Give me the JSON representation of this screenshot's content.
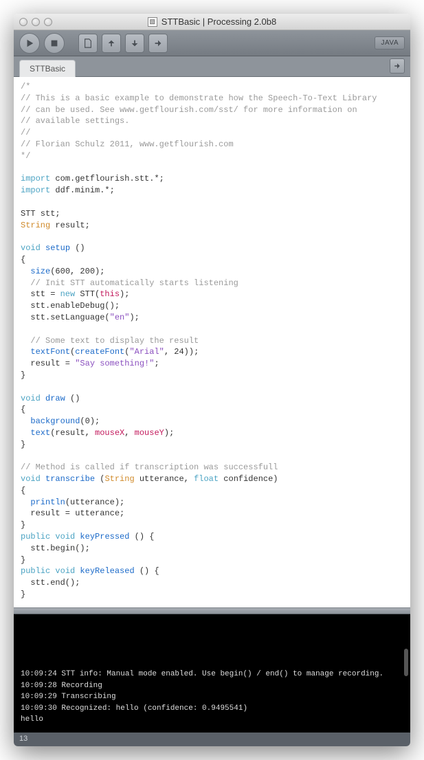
{
  "window": {
    "title": "STTBasic | Processing 2.0b8"
  },
  "toolbar": {
    "mode": "JAVA"
  },
  "tabs": {
    "active": "STTBasic"
  },
  "code": {
    "lines": [
      {
        "t": "comment",
        "s": "/*"
      },
      {
        "t": "comment",
        "s": "// This is a basic example to demonstrate how the Speech-To-Text Library"
      },
      {
        "t": "comment",
        "s": "// can be used. See www.getflourish.com/sst/ for more information on"
      },
      {
        "t": "comment",
        "s": "// available settings."
      },
      {
        "t": "comment",
        "s": "//"
      },
      {
        "t": "comment",
        "s": "// Florian Schulz 2011, www.getflourish.com"
      },
      {
        "t": "comment",
        "s": "*/"
      },
      {
        "t": "blank",
        "s": ""
      },
      {
        "t": "import",
        "kw": "import",
        "rest": " com.getflourish.stt.*;"
      },
      {
        "t": "import",
        "kw": "import",
        "rest": " ddf.minim.*;"
      },
      {
        "t": "blank",
        "s": ""
      },
      {
        "t": "decl",
        "s": "STT stt;"
      },
      {
        "t": "decl2",
        "type": "String",
        "rest": " result;"
      },
      {
        "t": "blank",
        "s": ""
      },
      {
        "t": "funcsig",
        "kw": "void",
        "name": " setup",
        "rest": " ()"
      },
      {
        "t": "plain",
        "s": "{"
      },
      {
        "t": "call",
        "indent": "  ",
        "fn": "size",
        "args": "(600, 200);"
      },
      {
        "t": "comment",
        "s": "  // Init STT automatically starts listening"
      },
      {
        "t": "newexpr",
        "indent": "  ",
        "pre": "stt = ",
        "kw": "new",
        "mid": " STT(",
        "arg": "this",
        "post": ");"
      },
      {
        "t": "plain",
        "s": "  stt.enableDebug();"
      },
      {
        "t": "strcall",
        "indent": "  ",
        "pre": "stt.setLanguage(",
        "str": "\"en\"",
        "post": ");"
      },
      {
        "t": "blank",
        "s": ""
      },
      {
        "t": "comment",
        "s": "  // Some text to display the result"
      },
      {
        "t": "fontcall",
        "indent": "  ",
        "fn1": "textFont",
        "open": "(",
        "fn2": "createFont",
        "args": "(",
        "str": "\"Arial\"",
        "rest": ", 24));"
      },
      {
        "t": "assign",
        "indent": "  ",
        "lhs": "result = ",
        "str": "\"Say something!\"",
        "post": ";"
      },
      {
        "t": "plain",
        "s": "}"
      },
      {
        "t": "blank",
        "s": ""
      },
      {
        "t": "funcsig",
        "kw": "void",
        "name": " draw",
        "rest": " ()"
      },
      {
        "t": "plain",
        "s": "{"
      },
      {
        "t": "call",
        "indent": "  ",
        "fn": "background",
        "args": "(0);"
      },
      {
        "t": "textcall",
        "indent": "  ",
        "fn": "text",
        "open": "(result, ",
        "a1": "mouseX",
        "mid": ", ",
        "a2": "mouseY",
        "post": ");"
      },
      {
        "t": "plain",
        "s": "}"
      },
      {
        "t": "blank",
        "s": ""
      },
      {
        "t": "comment",
        "s": "// Method is called if transcription was successfull"
      },
      {
        "t": "transig",
        "kw": "void",
        "name": " transcribe ",
        "open": "(",
        "t1": "String",
        "p1": " utterance, ",
        "t2": "float",
        "p2": " confidence)",
        "post": ""
      },
      {
        "t": "plain",
        "s": "{"
      },
      {
        "t": "call",
        "indent": "  ",
        "fn": "println",
        "args": "(utterance);"
      },
      {
        "t": "plain",
        "s": "  result = utterance;"
      },
      {
        "t": "plain",
        "s": "}"
      },
      {
        "t": "pubsig",
        "kw1": "public",
        "sp": " ",
        "kw2": "void",
        "name": " keyPressed",
        "rest": " () {"
      },
      {
        "t": "plain",
        "s": "  stt.begin();"
      },
      {
        "t": "plain",
        "s": "}"
      },
      {
        "t": "pubsig",
        "kw1": "public",
        "sp": " ",
        "kw2": "void",
        "name": " keyReleased",
        "rest": " () {"
      },
      {
        "t": "plain",
        "s": "  stt.end();"
      },
      {
        "t": "plain",
        "s": "}"
      }
    ]
  },
  "console": {
    "lines": [
      "10:09:24 STT info: Manual mode enabled. Use begin() / end() to manage recording.",
      "10:09:28 Recording",
      "10:09:29 Transcribing",
      "10:09:30 Recognized: hello (confidence: 0.9495541)",
      "hello"
    ]
  },
  "status": {
    "line": "13"
  }
}
